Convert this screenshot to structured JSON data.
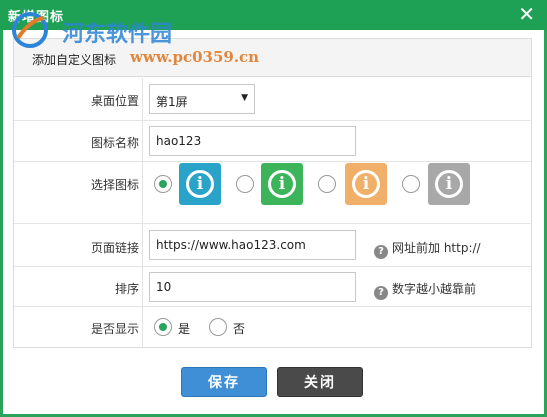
{
  "dialog": {
    "title": "新增图标",
    "close_glyph": "✕"
  },
  "watermark": {
    "name": "河东软件园",
    "url": "www.pc0359.cn"
  },
  "panel": {
    "heading": "添加自定义图标"
  },
  "form": {
    "desktop_position": {
      "label": "桌面位置",
      "value": "第1屏"
    },
    "icon_name": {
      "label": "图标名称",
      "value": "hao123"
    },
    "choose_icon": {
      "label": "选择图标",
      "options": [
        {
          "color": "#2aa3c9",
          "selected": true,
          "icon": "info-icon"
        },
        {
          "color": "#3cb55a",
          "selected": false,
          "icon": "info-icon"
        },
        {
          "color": "#f0b06a",
          "selected": false,
          "icon": "info-icon"
        },
        {
          "color": "#a8a8a8",
          "selected": false,
          "icon": "info-icon"
        }
      ]
    },
    "page_link": {
      "label": "页面链接",
      "value": "https://www.hao123.com",
      "hint": "网址前加 http://"
    },
    "sort": {
      "label": "排序",
      "value": "10",
      "hint": "数字越小越靠前"
    },
    "visible": {
      "label": "是否显示",
      "yes": "是",
      "no": "否",
      "selected": "yes"
    }
  },
  "buttons": {
    "save": "保存",
    "close": "关闭"
  },
  "colors": {
    "titlebar": "#1ea055",
    "radio_accent": "#2aa45c",
    "save_button": "#3f8fd6",
    "close_button": "#4a4a4a"
  }
}
